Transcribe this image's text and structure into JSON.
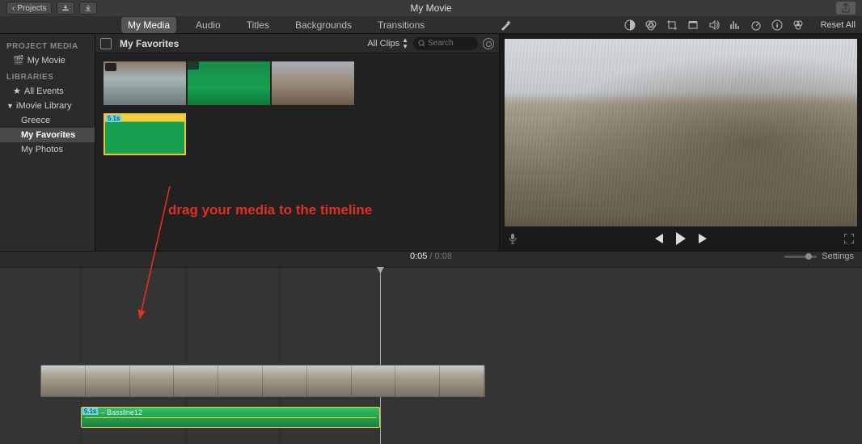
{
  "titlebar": {
    "back_label": "Projects",
    "title": "My Movie"
  },
  "tabs": {
    "items": [
      "My Media",
      "Audio",
      "Titles",
      "Backgrounds",
      "Transitions"
    ],
    "active_index": 0
  },
  "toolbar": {
    "reset_label": "Reset All"
  },
  "sidebar": {
    "section1_header": "PROJECT MEDIA",
    "project_name": "My Movie",
    "section2_header": "LIBRARIES",
    "all_events": "All Events",
    "library_name": "iMovie Library",
    "events": [
      "Greece",
      "My Favorites",
      "My Photos"
    ],
    "selected_event_index": 1
  },
  "browser": {
    "title": "My Favorites",
    "clips_filter": "All Clips",
    "search_placeholder": "Search",
    "selected_clip_tag": "5.1s"
  },
  "preview": {
    "controls": {
      "prev": "prev",
      "play": "play",
      "next": "next"
    }
  },
  "timeline": {
    "current_time": "0:05",
    "duration": "0:08",
    "settings_label": "Settings",
    "audio_clip_label": "5.1s – Bassline12"
  },
  "annotation": {
    "text": "drag your media to the timeline"
  }
}
